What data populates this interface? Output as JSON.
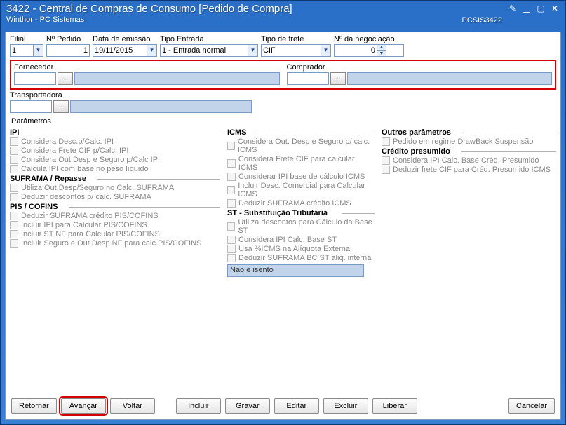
{
  "window": {
    "title": "3422 - Central de Compras de Consumo [Pedido de Compra]",
    "subtitle": "Winthor - PC Sistemas",
    "code": "PCSIS3422"
  },
  "top": {
    "filial_label": "Filial",
    "filial_value": "1",
    "npedido_label": "Nº Pedido",
    "npedido_value": "1",
    "data_label": "Data de emissão",
    "data_value": "19/11/2015",
    "tipoentrada_label": "Tipo Entrada",
    "tipoentrada_value": "1 - Entrada normal",
    "tipofrete_label": "Tipo de frete",
    "tipofrete_value": "CIF",
    "negociacao_label": "Nº da negociação",
    "negociacao_value": "0"
  },
  "lookup": {
    "fornecedor_label": "Fornecedor",
    "comprador_label": "Comprador",
    "transportadora_label": "Transportadora",
    "dots": "..."
  },
  "params_header": "Parâmetros",
  "groups": {
    "ipi": "IPI",
    "suframa": "SUFRAMA / Repasse",
    "piscofins": "PIS / COFINS",
    "icms": "ICMS",
    "st": "ST - Substituição Tributária",
    "outros": "Outros parâmetros",
    "credito": "Crédito presumido"
  },
  "ipi_items": [
    "Considera Desc.p/Calc. IPI",
    "Considera Frete CIF p/Calc. IPI",
    "Considera Out.Desp e Seguro p/Calc IPI",
    "Calcula IPI com base no peso líquido"
  ],
  "suframa_items": [
    "Utiliza Out.Desp/Seguro no Calc. SUFRAMA",
    "Deduzir descontos p/ calc. SUFRAMA"
  ],
  "piscofins_items": [
    "Deduzir SUFRAMA crédito PIS/COFINS",
    "Incluir IPI para Calcular PIS/COFINS",
    "Incluir ST NF para Calcular PIS/COFINS",
    "Incluir Seguro e Out.Desp.NF para calc.PIS/COFINS"
  ],
  "icms_items": [
    "Considera Out. Desp e Seguro p/ calc. ICMS",
    "Considera Frete CIF para calcular ICMS",
    "Considerar IPI base de cálculo ICMS",
    "Incluir Desc. Comercial para Calcular ICMS",
    "Deduzir SUFRAMA crédito ICMS"
  ],
  "st_items": [
    "Utiliza descontos para Cálculo da Base ST",
    "Considera IPI Calc. Base ST",
    "Usa %ICMS na Alíquota Externa",
    "Deduzir SUFRAMA BC ST aliq. interna"
  ],
  "isento": "Não é isento",
  "outros_items": [
    "Pedido em regime DrawBack Suspensão"
  ],
  "credito_items": [
    "Considera IPI Calc. Base Créd. Presumido",
    "Deduzir frete CIF para Créd. Presumido ICMS"
  ],
  "buttons": {
    "retornar": "Retornar",
    "avancar": "Avançar",
    "voltar": "Voltar",
    "incluir": "Incluir",
    "gravar": "Gravar",
    "editar": "Editar",
    "excluir": "Excluir",
    "liberar": "Liberar",
    "cancelar": "Cancelar"
  }
}
